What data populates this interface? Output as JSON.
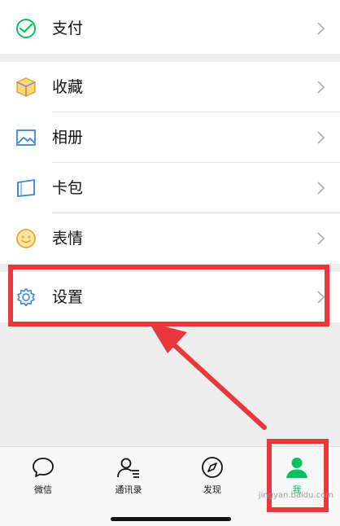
{
  "list": {
    "pay": "支付",
    "favorites": "收藏",
    "album": "相册",
    "cards": "卡包",
    "stickers": "表情",
    "settings": "设置"
  },
  "tabbar": {
    "chats": "微信",
    "contacts": "通讯录",
    "discover": "发现",
    "me": "我"
  },
  "colors": {
    "accent_green": "#07c160",
    "highlight_red": "#e8383d"
  },
  "watermark": "jingyan.baidu.com"
}
